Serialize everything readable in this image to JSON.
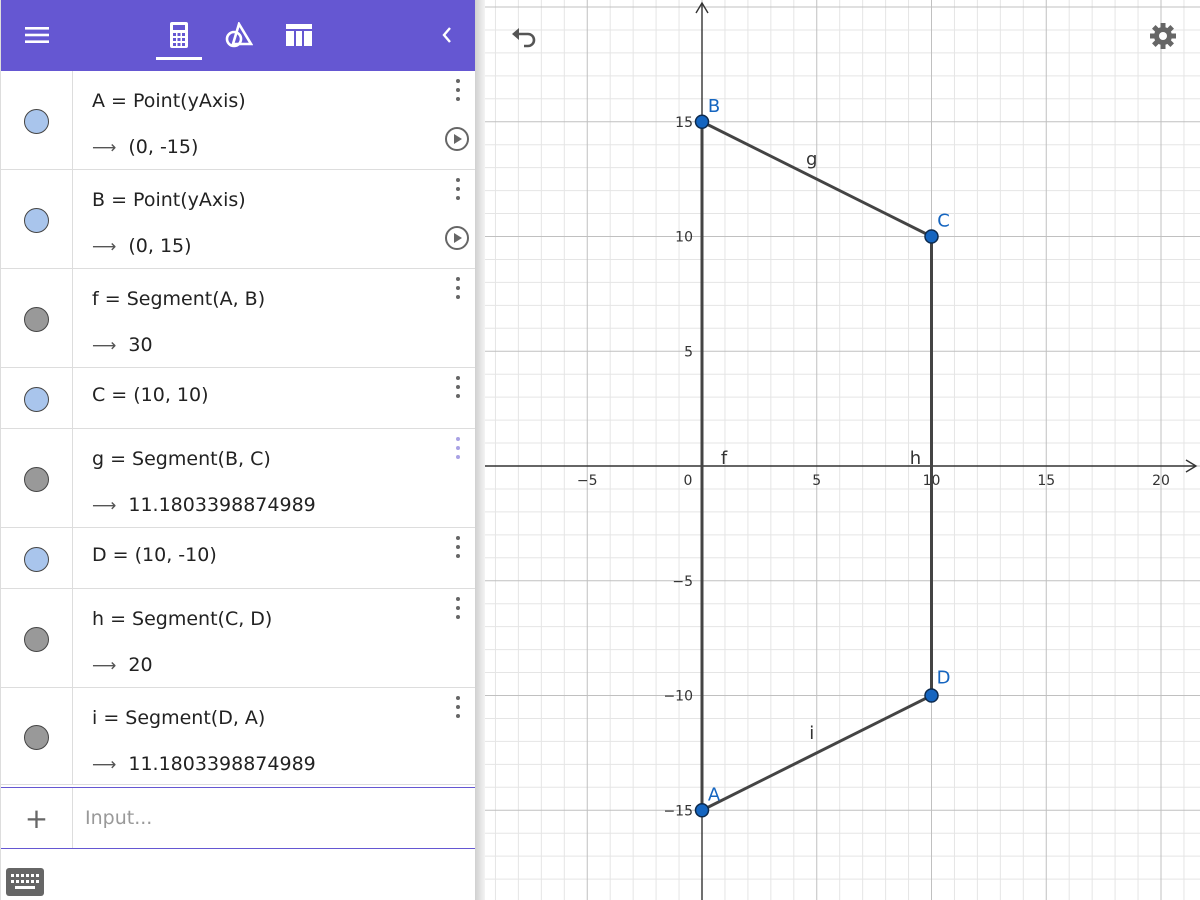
{
  "toolbar": {
    "accent_color": "#6557d2",
    "menu_icon": "hamburger-menu-icon",
    "tabs": [
      {
        "name": "algebra",
        "icon": "calculator-icon",
        "active": true
      },
      {
        "name": "tools",
        "icon": "geometry-tools-icon",
        "active": false
      },
      {
        "name": "table",
        "icon": "table-icon",
        "active": false
      }
    ],
    "collapse_icon": "chevron-left-icon"
  },
  "algebra_rows": [
    {
      "definition": "A = Point(yAxis)",
      "output": "(0, -15)",
      "marker_color": "#a9c5ec",
      "has_play": true
    },
    {
      "definition": "B = Point(yAxis)",
      "output": "(0, 15)",
      "marker_color": "#a9c5ec",
      "has_play": true
    },
    {
      "definition": "f = Segment(A, B)",
      "output": "30",
      "marker_color": "#999999",
      "has_play": false
    },
    {
      "definition": "C = (10, 10)",
      "output": null,
      "marker_color": "#a9c5ec",
      "has_play": false
    },
    {
      "definition": "g = Segment(B, C)",
      "output": "11.1803398874989",
      "marker_color": "#999999",
      "has_play": false
    },
    {
      "definition": "D = (10, -10)",
      "output": null,
      "marker_color": "#a9c5ec",
      "has_play": false
    },
    {
      "definition": "h = Segment(C, D)",
      "output": "20",
      "marker_color": "#999999",
      "has_play": false
    },
    {
      "definition": "i = Segment(D, A)",
      "output": "11.1803398874989",
      "marker_color": "#999999",
      "has_play": false
    }
  ],
  "input": {
    "placeholder": "Input...",
    "add_icon": "plus-icon"
  },
  "graphics": {
    "undo_icon": "undo-icon",
    "settings_icon": "gear-icon",
    "x_tick_labels": [
      "−5",
      "0",
      "5",
      "10",
      "15",
      "20"
    ],
    "y_tick_labels": [
      "15",
      "10",
      "5",
      "−5",
      "−10",
      "−15"
    ],
    "points": [
      {
        "name": "A",
        "x": 0,
        "y": -15
      },
      {
        "name": "B",
        "x": 0,
        "y": 15
      },
      {
        "name": "C",
        "x": 10,
        "y": 10
      },
      {
        "name": "D",
        "x": 10,
        "y": -10
      }
    ],
    "segments": [
      {
        "name": "f",
        "from": "A",
        "to": "B"
      },
      {
        "name": "g",
        "from": "B",
        "to": "C"
      },
      {
        "name": "h",
        "from": "C",
        "to": "D"
      },
      {
        "name": "i",
        "from": "D",
        "to": "A"
      }
    ],
    "point_color": "#1565c0",
    "point_label_color": "#1565c0",
    "segment_color": "#444444"
  }
}
